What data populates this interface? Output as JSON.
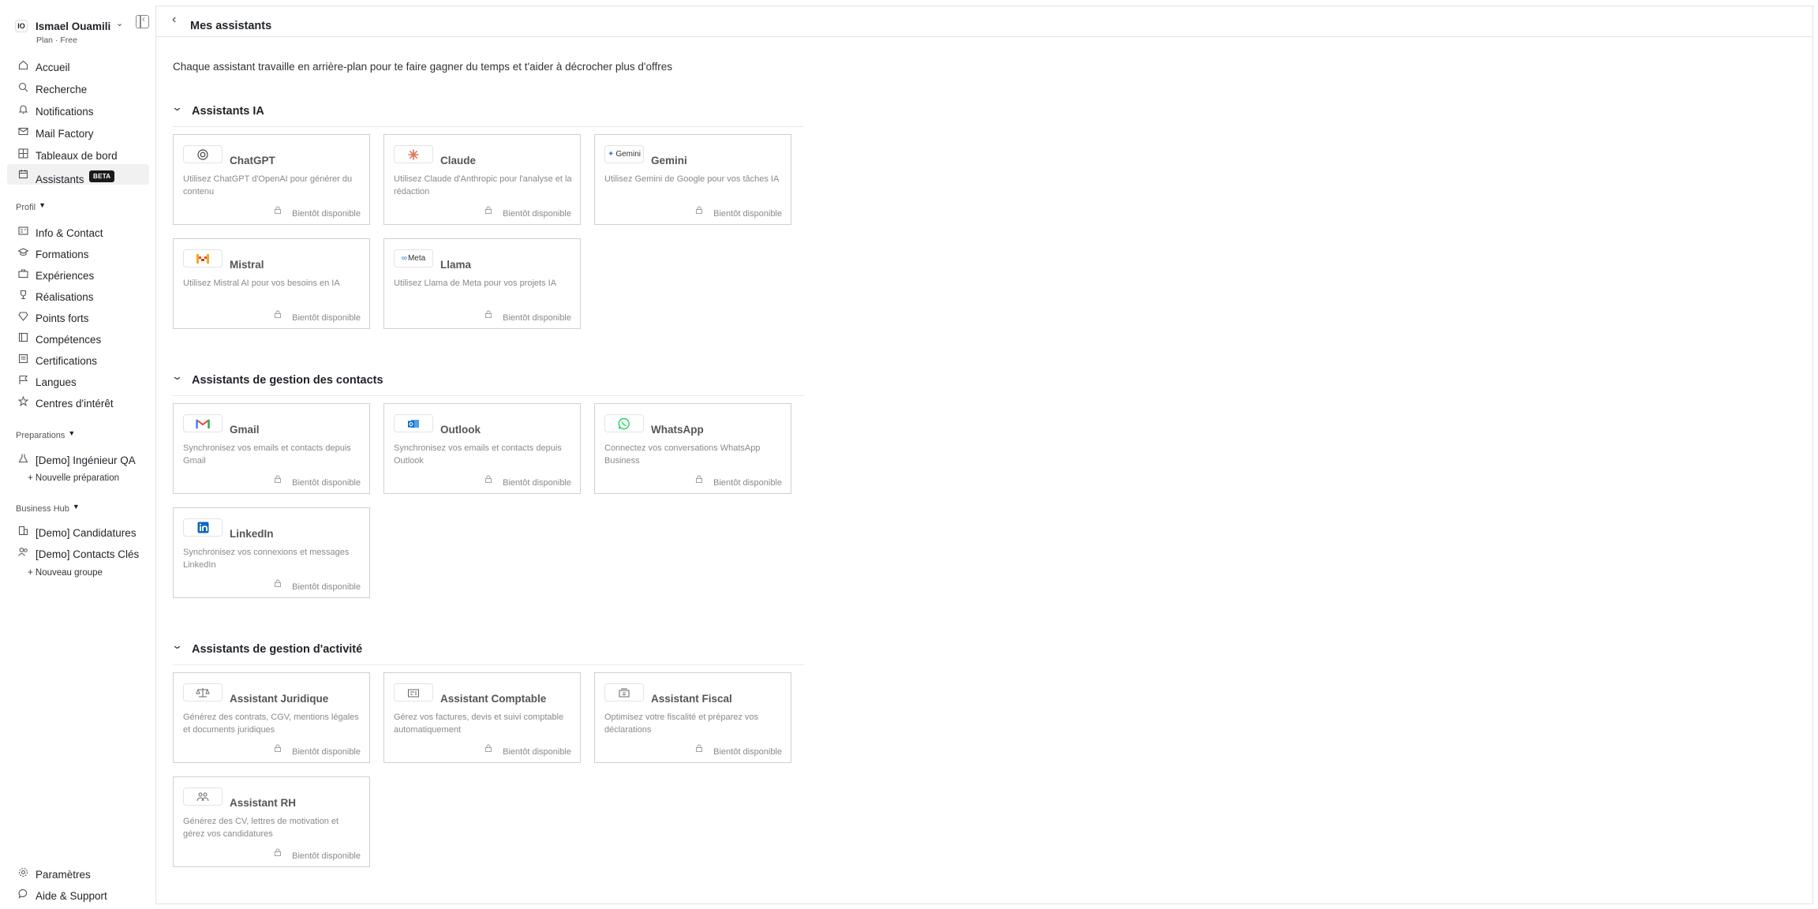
{
  "user": {
    "initials": "IO",
    "name": "Ismael Ouamili",
    "plan": "Plan · Free"
  },
  "nav": {
    "main": [
      {
        "label": "Accueil",
        "icon": "home-icon"
      },
      {
        "label": "Recherche",
        "icon": "search-icon"
      },
      {
        "label": "Notifications",
        "icon": "bell-icon"
      },
      {
        "label": "Mail Factory",
        "icon": "mail-icon"
      },
      {
        "label": "Tableaux de bord",
        "icon": "grid-icon"
      },
      {
        "label": "Assistants",
        "icon": "calendar-icon",
        "badge": "BETA"
      }
    ],
    "profile_header": "Profil",
    "profile": [
      {
        "label": "Info & Contact"
      },
      {
        "label": "Formations"
      },
      {
        "label": "Expériences"
      },
      {
        "label": "Réalisations"
      },
      {
        "label": "Points forts"
      },
      {
        "label": "Compétences"
      },
      {
        "label": "Certifications"
      },
      {
        "label": "Langues"
      },
      {
        "label": "Centres d'intérêt"
      }
    ],
    "preparations_header": "Preparations",
    "preparations": [
      {
        "label": "[Demo] Ingénieur QA"
      }
    ],
    "new_preparation": "+ Nouvelle préparation",
    "business_header": "Business Hub",
    "business": [
      {
        "label": "[Demo] Candidatures"
      },
      {
        "label": "[Demo] Contacts Clés"
      }
    ],
    "new_group": "+ Nouveau groupe",
    "bottom": [
      {
        "label": "Paramètres"
      },
      {
        "label": "Aide & Support"
      }
    ]
  },
  "page": {
    "title": "Mes assistants",
    "subtitle": "Chaque assistant travaille en arrière-plan pour te faire gagner du temps et t'aider à décrocher plus d'offres"
  },
  "soon_label": "Bientôt disponible",
  "groups": [
    {
      "title": "Assistants IA",
      "cards": [
        {
          "name": "ChatGPT",
          "desc": "Utilisez ChatGPT d'OpenAI pour générer du contenu",
          "logo": "openai-logo"
        },
        {
          "name": "Claude",
          "desc": "Utilisez Claude d'Anthropic pour l'analyse et la rédaction",
          "logo": "claude-logo"
        },
        {
          "name": "Gemini",
          "desc": "Utilisez Gemini de Google pour vos tâches IA",
          "logo": "gemini-logo",
          "logo_text": "Gemini"
        },
        {
          "name": "Mistral",
          "desc": "Utilisez Mistral AI pour vos besoins en IA",
          "logo": "mistral-logo"
        },
        {
          "name": "Llama",
          "desc": "Utilisez Llama de Meta pour vos projets IA",
          "logo": "meta-logo",
          "logo_text": "Meta"
        }
      ]
    },
    {
      "title": "Assistants de gestion des contacts",
      "cards": [
        {
          "name": "Gmail",
          "desc": "Synchronisez vos emails et contacts depuis Gmail",
          "logo": "gmail-logo"
        },
        {
          "name": "Outlook",
          "desc": "Synchronisez vos emails et contacts depuis Outlook",
          "logo": "outlook-logo"
        },
        {
          "name": "WhatsApp",
          "desc": "Connectez vos conversations WhatsApp Business",
          "logo": "whatsapp-logo"
        },
        {
          "name": "LinkedIn",
          "desc": "Synchronisez vos connexions et messages LinkedIn",
          "logo": "linkedin-logo"
        }
      ]
    },
    {
      "title": "Assistants de gestion d'activité",
      "cards": [
        {
          "name": "Assistant Juridique",
          "desc": "Générez des contrats, CGV, mentions légales et documents juridiques",
          "logo": "legal-logo"
        },
        {
          "name": "Assistant Comptable",
          "desc": "Gérez vos factures, devis et suivi comptable automatiquement",
          "logo": "accounting-logo"
        },
        {
          "name": "Assistant Fiscal",
          "desc": "Optimisez votre fiscalité et préparez vos déclarations",
          "logo": "tax-logo"
        },
        {
          "name": "Assistant RH",
          "desc": "Générez des CV, lettres de motivation et gérez vos candidatures",
          "logo": "hr-logo"
        }
      ]
    }
  ],
  "colors": {
    "accent": "#1a1a1a",
    "border": "#d0d0d0",
    "muted": "#8a8a8a"
  }
}
